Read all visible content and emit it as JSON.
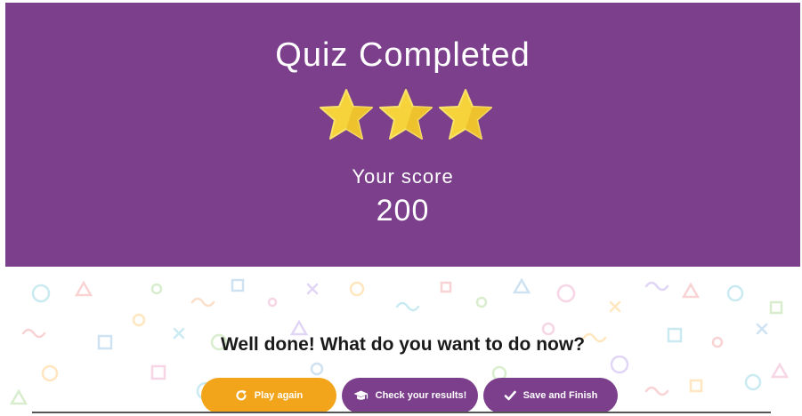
{
  "header": {
    "title": "Quiz Completed",
    "stars_earned": 3,
    "stars_total": 3,
    "score_label": "Your score",
    "score_value": "200"
  },
  "prompt": "Well done! What do you want to do now?",
  "actions": {
    "play_again": {
      "label": "Play again",
      "icon": "refresh-icon"
    },
    "check_results": {
      "label": "Check your results!",
      "icon": "graduation-cap-icon"
    },
    "save_finish": {
      "label": "Save and Finish",
      "icon": "checkmark-icon"
    }
  },
  "colors": {
    "brand_purple": "#7b3f8c",
    "accent_orange": "#f2a41a",
    "star_yellow": "#f6d33a"
  }
}
